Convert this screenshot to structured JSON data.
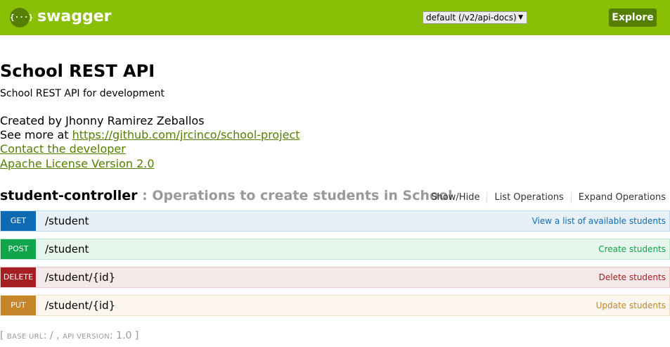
{
  "header": {
    "logo_glyph": "{···}",
    "logo_text": "swagger",
    "spec_select": "default (/v2/api-docs)",
    "caret": "▼",
    "explore_label": "Explore"
  },
  "info": {
    "title": "School REST API",
    "description": "School REST API for development",
    "created_by": "Created by Jhonny Ramirez Zeballos",
    "see_more_prefix": "See more at ",
    "see_more_link": "https://github.com/jrcinco/school-project",
    "contact_link": "Contact the developer",
    "license_link": "Apache License Version 2.0"
  },
  "resource": {
    "name": "student-controller",
    "description": " : Operations to create students in School",
    "actions": [
      "Show/Hide",
      "List Operations",
      "Expand Operations"
    ],
    "operations": [
      {
        "method": "GET",
        "path": "/student",
        "summary": "View a list of available students"
      },
      {
        "method": "POST",
        "path": "/student",
        "summary": "Create students"
      },
      {
        "method": "DELETE",
        "path": "/student/{id}",
        "summary": "Delete students"
      },
      {
        "method": "PUT",
        "path": "/student/{id}",
        "summary": "Update students"
      }
    ]
  },
  "footer": {
    "open": "[ ",
    "base_url_label": "base url",
    "base_url_value": ": / , ",
    "api_version_label": "api version",
    "api_version_value": ": 1.0 ]"
  },
  "colors": {
    "header_bg": "#89bf04",
    "explore_bg": "#547f00",
    "get": "#0f6ab4",
    "post": "#10a54a",
    "delete": "#a41e22",
    "put": "#c5862b"
  }
}
